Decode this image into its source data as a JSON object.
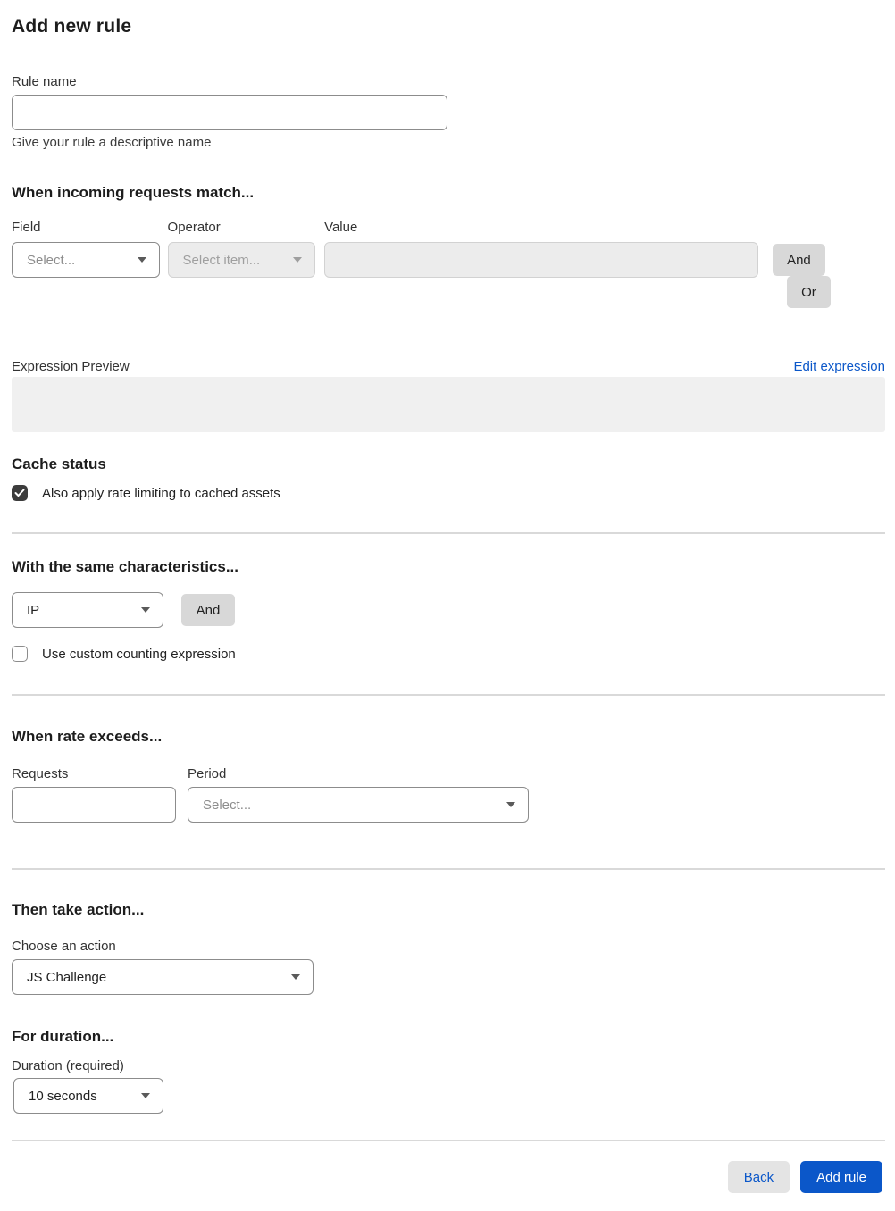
{
  "page": {
    "title": "Add new rule"
  },
  "rule_name": {
    "label": "Rule name",
    "value": "",
    "helper": "Give your rule a descriptive name"
  },
  "match": {
    "heading": "When incoming requests match...",
    "field_label": "Field",
    "field_value": "Select...",
    "operator_label": "Operator",
    "operator_value": "Select item...",
    "operator_disabled": true,
    "value_label": "Value",
    "value_text": "",
    "value_disabled": true,
    "and_button": "And",
    "or_button": "Or"
  },
  "expression": {
    "label": "Expression Preview",
    "edit_link": "Edit expression",
    "content": ""
  },
  "cache": {
    "heading": "Cache status",
    "checkbox_label": "Also apply rate limiting to cached assets",
    "checked": true
  },
  "characteristics": {
    "heading": "With the same characteristics...",
    "select_value": "IP",
    "and_button": "And",
    "checkbox_label": "Use custom counting expression",
    "checked": false
  },
  "rate": {
    "heading": "When rate exceeds...",
    "requests_label": "Requests",
    "requests_value": "",
    "period_label": "Period",
    "period_value": "Select..."
  },
  "action": {
    "heading": "Then take action...",
    "label": "Choose an action",
    "value": "JS Challenge"
  },
  "duration": {
    "heading": "For duration...",
    "label": "Duration (required)",
    "value": "10 seconds"
  },
  "footer": {
    "back_button": "Back",
    "add_button": "Add rule"
  },
  "colors": {
    "accent_blue": "#0b57c9",
    "checkbox_checked": "#3c3c3c",
    "disabled_bg": "#ececec",
    "expression_box_bg": "#f0f0f0"
  }
}
